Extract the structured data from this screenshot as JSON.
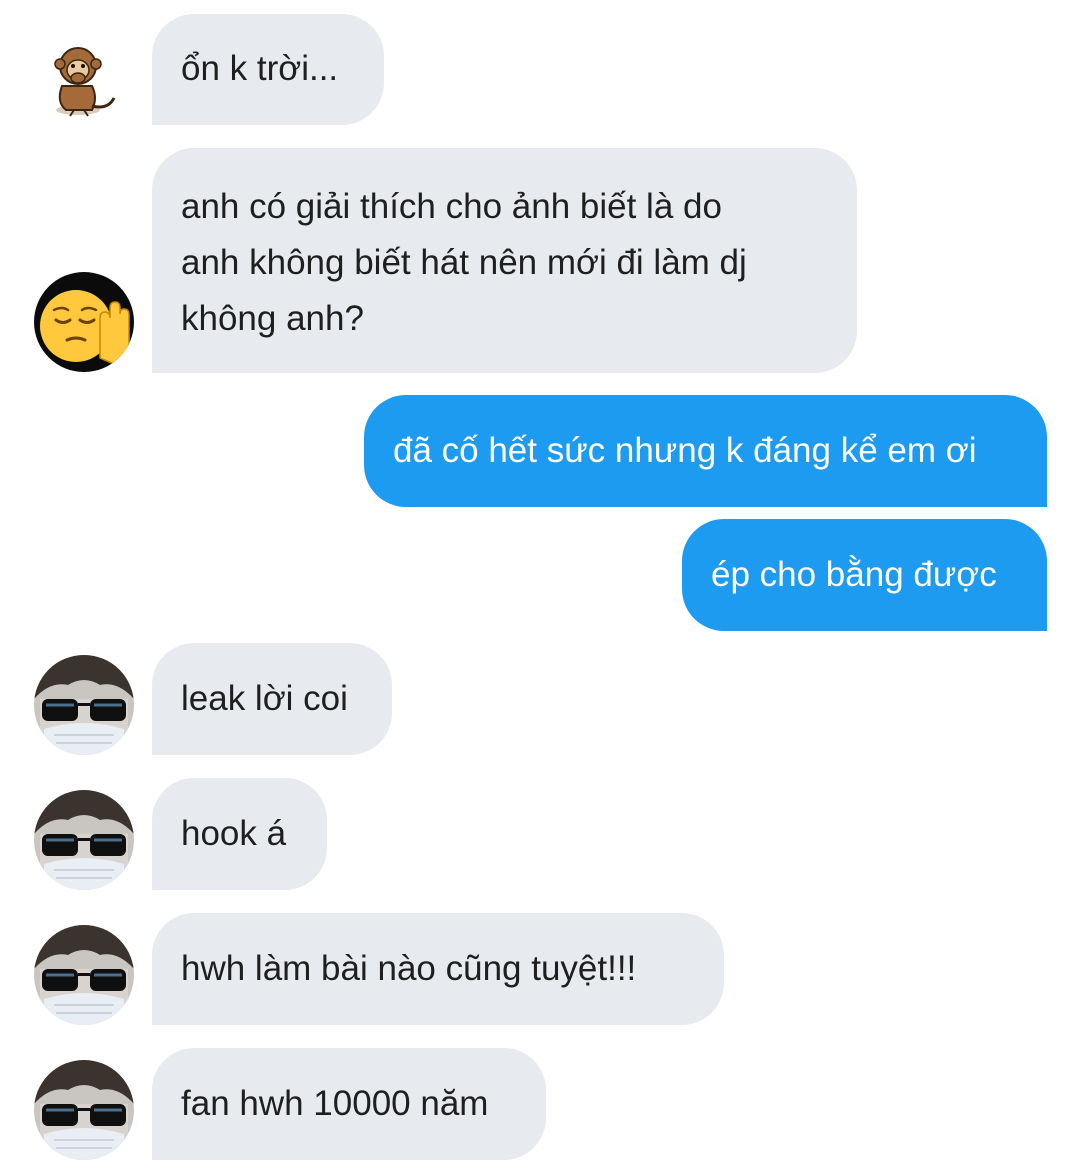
{
  "messages": [
    {
      "from": "them",
      "avatar": "monkey-sticker-icon",
      "text": "ổn k trời..."
    },
    {
      "from": "them",
      "avatar": "pensive-hand-emoji-icon",
      "lines": [
        "anh có giải thích cho ảnh biết là do",
        "anh không biết hát nên mới đi làm dj",
        "không anh?"
      ]
    },
    {
      "from": "me",
      "text": "đã cố hết sức nhưng k đáng kể em ơi"
    },
    {
      "from": "me",
      "text": "ép cho bằng được"
    },
    {
      "from": "them",
      "avatar": "sunglasses-mask-avatar",
      "text": "leak lời coi"
    },
    {
      "from": "them",
      "avatar": "sunglasses-mask-avatar",
      "text": "hook á"
    },
    {
      "from": "them",
      "avatar": "sunglasses-mask-avatar",
      "text": "hwh làm bài nào cũng tuyệt!!!"
    },
    {
      "from": "them",
      "avatar": "sunglasses-mask-avatar",
      "text": "fan hwh 10000 năm"
    }
  ],
  "colors": {
    "incoming_bubble": "#e7ebf0",
    "outgoing_bubble": "#1d9bf0",
    "incoming_text": "#1f1f1f",
    "outgoing_text": "#ffffff",
    "background": "#ffffff"
  }
}
